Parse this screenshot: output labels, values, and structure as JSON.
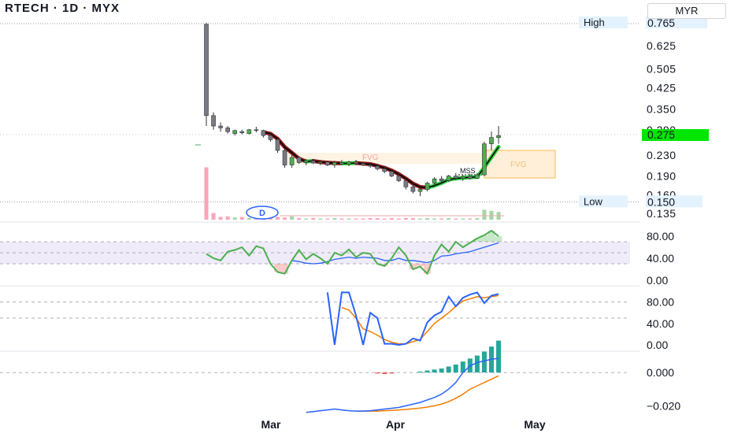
{
  "header": {
    "title": "RTECH · 1D · MYX",
    "currency": "MYR"
  },
  "colors": {
    "up": "#4caf50",
    "down": "#787b86",
    "ma_fast": "#000000",
    "ma_up": "#2ecc40",
    "ma_down": "#8b1a1a",
    "rsi": "#4caf50",
    "rsi_ma": "#2962ff",
    "stoch_k": "#2962ff",
    "stoch_d": "#f57c00",
    "macd": "#2962ff",
    "signal": "#f57c00",
    "hist_pos": "#26a69a",
    "hist_neg": "#ef5350",
    "fvg": "#ffb74d",
    "price_tag": "#00e600"
  },
  "annotations": {
    "high_label": "High",
    "high_value": "0.765",
    "low_label": "Low",
    "low_value": "0.150",
    "last_price": "0.275",
    "fvg_label": "FVG",
    "mss_label": "MSS",
    "badge": "D"
  },
  "chart_data": [
    {
      "type": "candlestick",
      "title": "RTECH · 1D · MYX",
      "x_ticks": [
        "Mar",
        "Apr",
        "May"
      ],
      "y_ticks": [
        "0.765",
        "0.625",
        "0.505",
        "0.425",
        "0.350",
        "0.290",
        "0.230",
        "0.190",
        "0.160",
        "0.135"
      ],
      "ylim": [
        0.135,
        0.765
      ],
      "log_scale": true,
      "candles": [
        [
          0.76,
          0.77,
          0.3,
          0.33
        ],
        [
          0.33,
          0.34,
          0.29,
          0.3
        ],
        [
          0.3,
          0.31,
          0.285,
          0.295
        ],
        [
          0.295,
          0.3,
          0.28,
          0.285
        ],
        [
          0.28,
          0.29,
          0.275,
          0.288
        ],
        [
          0.285,
          0.29,
          0.278,
          0.282
        ],
        [
          0.28,
          0.292,
          0.278,
          0.29
        ],
        [
          0.29,
          0.298,
          0.283,
          0.288
        ],
        [
          0.288,
          0.29,
          0.27,
          0.275
        ],
        [
          0.275,
          0.28,
          0.26,
          0.265
        ],
        [
          0.265,
          0.268,
          0.235,
          0.24
        ],
        [
          0.24,
          0.245,
          0.205,
          0.21
        ],
        [
          0.21,
          0.23,
          0.205,
          0.225
        ],
        [
          0.225,
          0.228,
          0.212,
          0.215
        ],
        [
          0.215,
          0.222,
          0.21,
          0.218
        ],
        [
          0.218,
          0.222,
          0.212,
          0.214
        ],
        [
          0.214,
          0.22,
          0.21,
          0.216
        ],
        [
          0.216,
          0.218,
          0.208,
          0.21
        ],
        [
          0.21,
          0.218,
          0.205,
          0.215
        ],
        [
          0.215,
          0.22,
          0.21,
          0.212
        ],
        [
          0.212,
          0.218,
          0.208,
          0.216
        ],
        [
          0.216,
          0.22,
          0.21,
          0.213
        ],
        [
          0.213,
          0.216,
          0.208,
          0.21
        ],
        [
          0.21,
          0.214,
          0.205,
          0.208
        ],
        [
          0.208,
          0.212,
          0.2,
          0.203
        ],
        [
          0.203,
          0.208,
          0.195,
          0.198
        ],
        [
          0.198,
          0.202,
          0.188,
          0.19
        ],
        [
          0.19,
          0.195,
          0.18,
          0.182
        ],
        [
          0.182,
          0.185,
          0.168,
          0.172
        ],
        [
          0.172,
          0.178,
          0.162,
          0.165
        ],
        [
          0.165,
          0.172,
          0.158,
          0.168
        ],
        [
          0.168,
          0.18,
          0.165,
          0.178
        ],
        [
          0.178,
          0.188,
          0.172,
          0.185
        ],
        [
          0.185,
          0.19,
          0.178,
          0.182
        ],
        [
          0.182,
          0.192,
          0.18,
          0.19
        ],
        [
          0.19,
          0.195,
          0.183,
          0.186
        ],
        [
          0.186,
          0.192,
          0.182,
          0.189
        ],
        [
          0.189,
          0.194,
          0.184,
          0.186
        ],
        [
          0.186,
          0.195,
          0.185,
          0.192
        ],
        [
          0.192,
          0.26,
          0.19,
          0.255
        ],
        [
          0.255,
          0.285,
          0.24,
          0.27
        ],
        [
          0.27,
          0.3,
          0.255,
          0.275
        ]
      ],
      "volume": [
        0.95,
        0.12,
        0.05,
        0.06,
        0.04,
        0.05,
        0.03,
        0.04,
        0.06,
        0.03,
        0.05,
        0.04,
        0.06,
        0.03,
        0.02,
        0.03,
        0.02,
        0.02,
        0.03,
        0.02,
        0.02,
        0.02,
        0.02,
        0.03,
        0.03,
        0.02,
        0.03,
        0.02,
        0.03,
        0.03,
        0.02,
        0.03,
        0.02,
        0.02,
        0.03,
        0.02,
        0.02,
        0.02,
        0.03,
        0.18,
        0.16,
        0.14
      ]
    },
    {
      "type": "line",
      "name": "RSI",
      "y_ticks": [
        "80.00",
        "40.00",
        "0.00"
      ],
      "ylim": [
        0,
        100
      ],
      "band": [
        30,
        70
      ],
      "series": [
        {
          "values": [
            48,
            40,
            36,
            52,
            55,
            60,
            45,
            62,
            58,
            30,
            15,
            12,
            36,
            55,
            38,
            48,
            40,
            30,
            50,
            45,
            56,
            42,
            50,
            48,
            30,
            26,
            40,
            60,
            45,
            20,
            25,
            12,
            45,
            65,
            52,
            70,
            60,
            68,
            76,
            82,
            90,
            80
          ]
        },
        {
          "values": [
            null,
            null,
            null,
            null,
            null,
            null,
            null,
            null,
            null,
            null,
            null,
            null,
            36,
            34,
            31,
            30,
            31,
            34,
            38,
            40,
            42,
            40,
            42,
            41,
            40,
            36,
            36,
            40,
            36,
            36,
            34,
            32,
            36,
            44,
            45,
            48,
            50,
            52,
            56,
            60,
            64,
            68
          ]
        }
      ]
    },
    {
      "type": "line",
      "name": "Stoch",
      "y_ticks": [
        "80.00",
        "40.00",
        "0.00"
      ],
      "ylim": [
        0,
        100
      ],
      "series": [
        {
          "values": [
            null,
            null,
            null,
            null,
            null,
            null,
            null,
            null,
            null,
            null,
            null,
            null,
            null,
            null,
            null,
            null,
            null,
            98,
            0,
            98,
            98,
            55,
            0,
            60,
            50,
            2,
            2,
            0,
            2,
            12,
            8,
            42,
            55,
            62,
            90,
            72,
            88,
            94,
            98,
            78,
            92,
            95
          ]
        },
        {
          "values": [
            null,
            null,
            null,
            null,
            null,
            null,
            null,
            null,
            null,
            null,
            null,
            null,
            null,
            null,
            null,
            null,
            null,
            null,
            null,
            70,
            65,
            50,
            30,
            25,
            18,
            10,
            5,
            2,
            2,
            6,
            10,
            25,
            40,
            50,
            60,
            72,
            82,
            86,
            90,
            88,
            90,
            92
          ]
        }
      ]
    },
    {
      "type": "line",
      "name": "MACD",
      "y_ticks": [
        "0.000",
        "−0.020"
      ],
      "ylim": [
        -0.026,
        0.01
      ],
      "series": [
        {
          "values": [
            null,
            null,
            null,
            null,
            null,
            null,
            null,
            null,
            null,
            null,
            null,
            null,
            null,
            null,
            -0.024,
            -0.0235,
            -0.023,
            -0.0225,
            -0.022,
            -0.0225,
            -0.023,
            -0.0232,
            -0.0232,
            -0.023,
            -0.0225,
            -0.022,
            -0.0215,
            -0.021,
            -0.02,
            -0.019,
            -0.018,
            -0.0165,
            -0.015,
            -0.013,
            -0.01,
            -0.006,
            0.0,
            0.004,
            0.006,
            0.007,
            0.008,
            0.0085
          ]
        },
        {
          "values": [
            null,
            null,
            null,
            null,
            null,
            null,
            null,
            null,
            null,
            null,
            null,
            null,
            null,
            null,
            null,
            null,
            null,
            null,
            null,
            null,
            null,
            -0.0232,
            -0.0232,
            -0.0232,
            -0.0232,
            -0.023,
            -0.0228,
            -0.0225,
            -0.0222,
            -0.0218,
            -0.0214,
            -0.0208,
            -0.02,
            -0.019,
            -0.0175,
            -0.0155,
            -0.013,
            -0.01,
            -0.008,
            -0.006,
            -0.004,
            -0.002
          ]
        }
      ],
      "histogram": [
        0,
        0,
        0,
        0,
        0,
        0,
        0,
        0,
        0,
        0,
        0,
        0,
        0,
        0,
        0,
        0,
        0,
        0,
        0,
        0,
        0,
        0,
        0,
        0,
        -0.0002,
        -0.0003,
        -0.0002,
        0,
        0,
        0,
        0.0002,
        0.0004,
        0.0006,
        0.0008,
        0.0012,
        0.0016,
        0.0022,
        0.0028,
        0.0034,
        0.0042,
        0.0052,
        0.0064
      ]
    }
  ]
}
